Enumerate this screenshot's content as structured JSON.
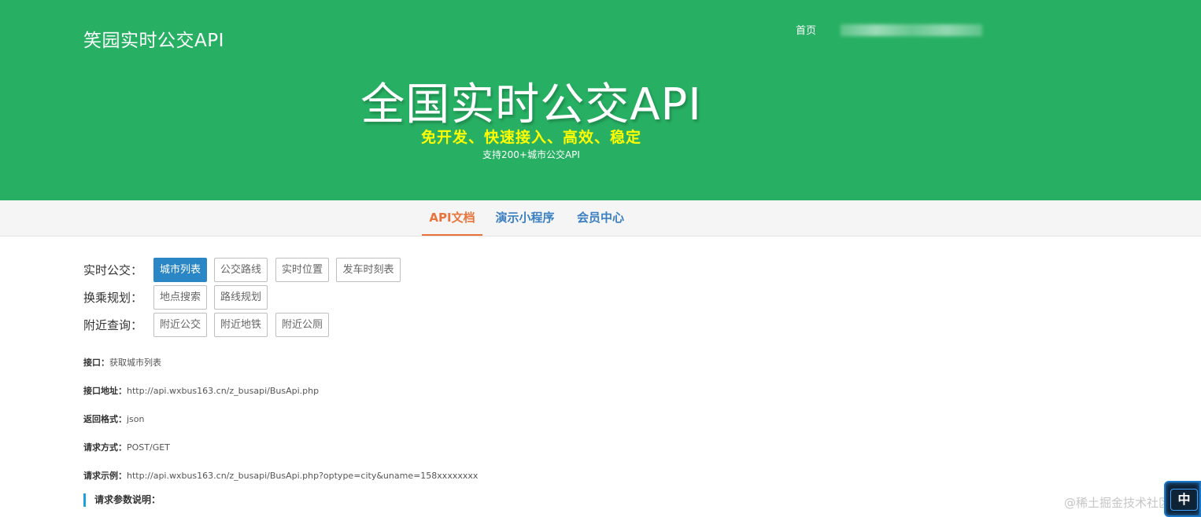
{
  "header": {
    "brand": "笑园实时公交API",
    "nav_home": "首页",
    "hero_title": "全国实时公交API",
    "hero_slogan": "免开发、快速接入、高效、稳定",
    "hero_subtitle": "支持200+城市公交API",
    "colors": {
      "background": "#27b063",
      "slogan": "#ffff00"
    }
  },
  "tabs": [
    {
      "label": "API文档",
      "active": true
    },
    {
      "label": "演示小程序",
      "active": false
    },
    {
      "label": "会员中心",
      "active": false
    }
  ],
  "categories": [
    {
      "label": "实时公交：",
      "buttons": [
        {
          "label": "城市列表",
          "active": true
        },
        {
          "label": "公交路线",
          "active": false
        },
        {
          "label": "实时位置",
          "active": false
        },
        {
          "label": "发车时刻表",
          "active": false
        }
      ]
    },
    {
      "label": "换乘规划：",
      "buttons": [
        {
          "label": "地点搜索",
          "active": false
        },
        {
          "label": "路线规划",
          "active": false
        }
      ]
    },
    {
      "label": "附近查询：",
      "buttons": [
        {
          "label": "附近公交",
          "active": false
        },
        {
          "label": "附近地铁",
          "active": false
        },
        {
          "label": "附近公厕",
          "active": false
        }
      ]
    }
  ],
  "api_info": [
    {
      "key": "接口：",
      "value": "获取城市列表"
    },
    {
      "key": "接口地址：",
      "value": "http://api.wxbus163.cn/z_busapi/BusApi.php"
    },
    {
      "key": "返回格式：",
      "value": "json"
    },
    {
      "key": "请求方式：",
      "value": "POST/GET"
    },
    {
      "key": "请求示例：",
      "value": "http://api.wxbus163.cn/z_busapi/BusApi.php?optype=city&uname=158xxxxxxxx"
    }
  ],
  "params_heading": "请求参数说明：",
  "watermark": "@稀土掘金技术社区",
  "float_widget_label": "中"
}
